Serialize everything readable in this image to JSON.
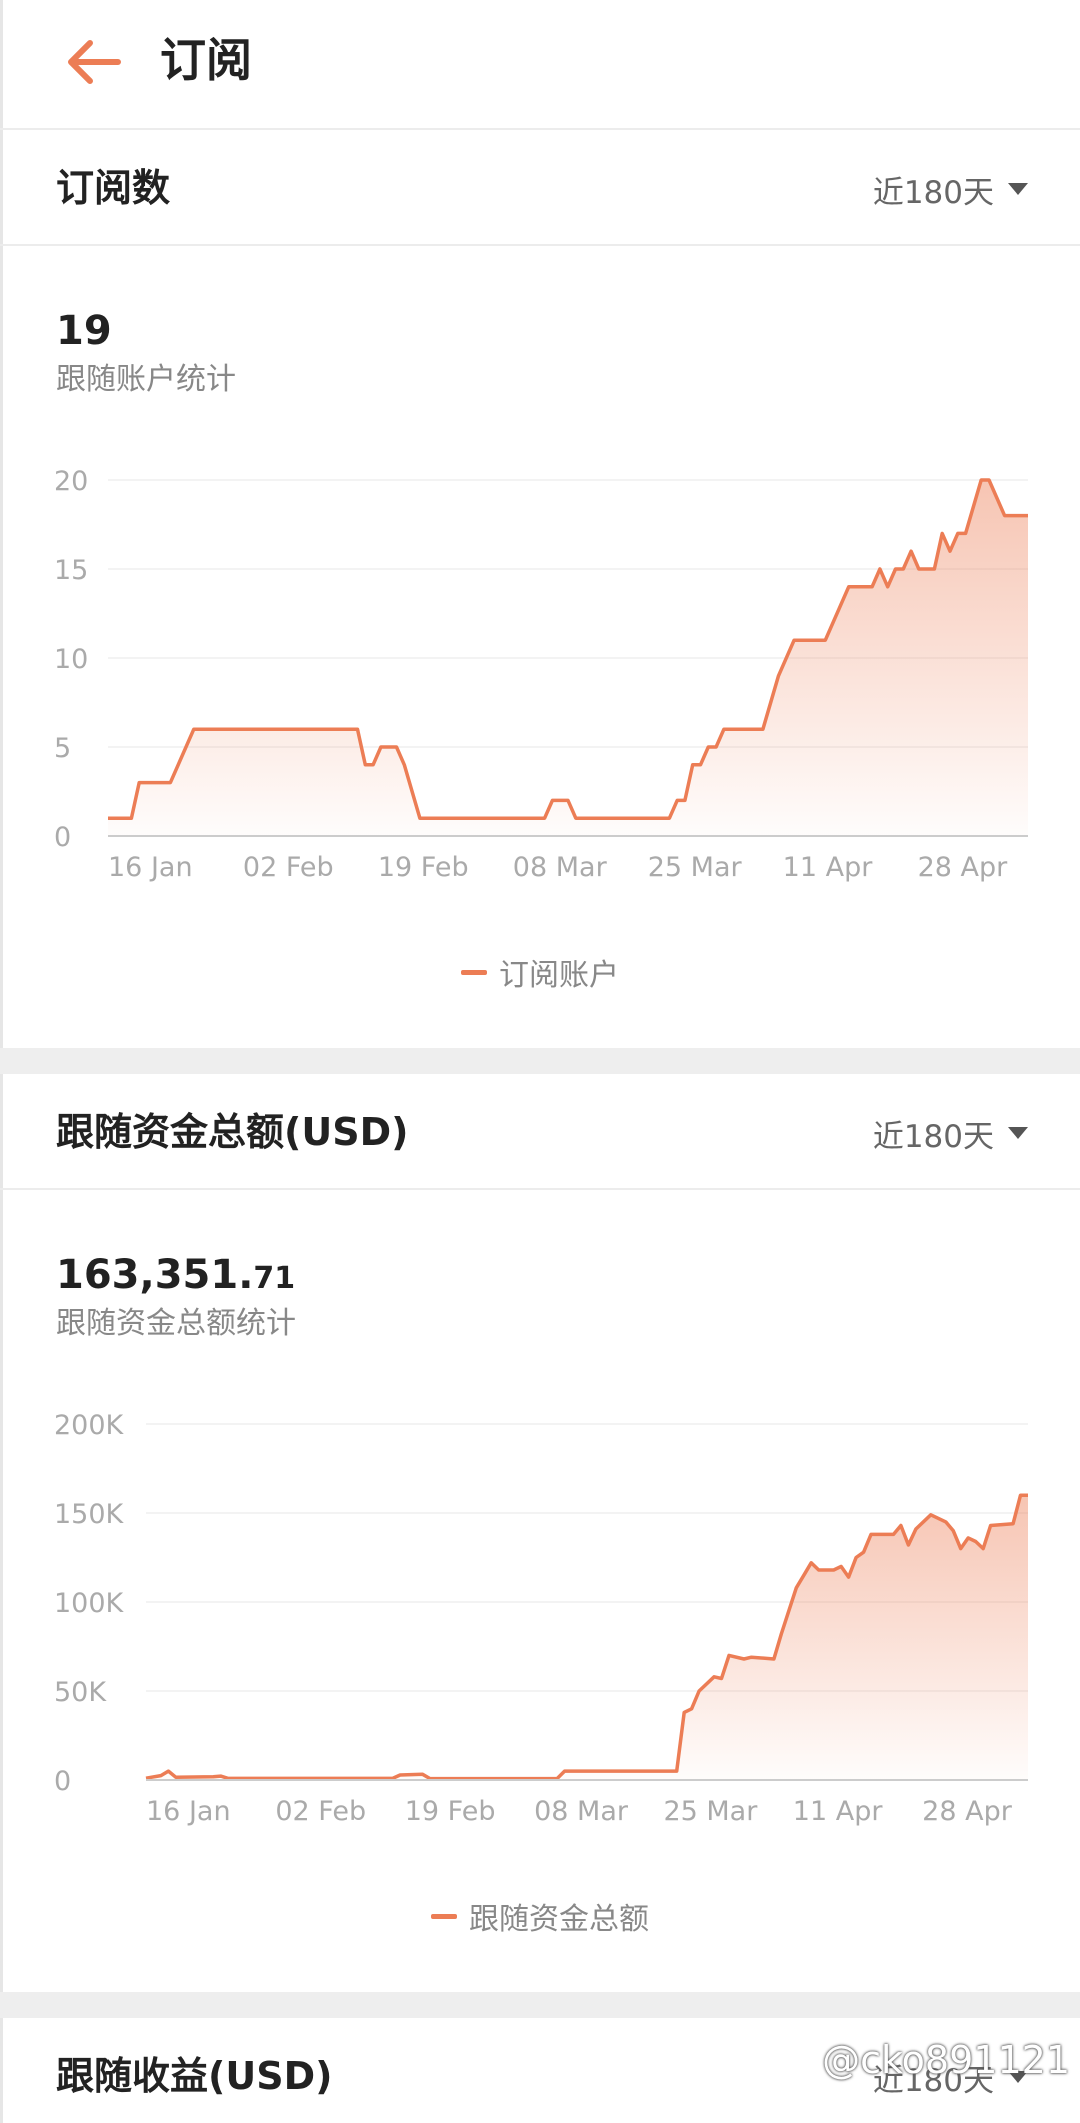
{
  "header": {
    "title": "订阅"
  },
  "colors": {
    "accent": "#ec7d55",
    "grid": "#efefef",
    "axis": "#cccccc",
    "tick": "#aaaaaa",
    "divider": "#eeeeee"
  },
  "icons": {
    "back": "arrow-left-icon",
    "dropdown": "caret-down-icon"
  },
  "sections": [
    {
      "title": "订阅数",
      "range": "近180天",
      "value_main": "19",
      "value_frac": "",
      "subtitle": "跟随账户统计",
      "legend": "订阅账户"
    },
    {
      "title": "跟随资金总额(USD)",
      "range": "近180天",
      "value_main": "163,351.",
      "value_frac": "71",
      "subtitle": "跟随资金总额统计",
      "legend": "跟随资金总额"
    },
    {
      "title": "跟随收益(USD)",
      "range": "近180天"
    }
  ],
  "chart_data": [
    {
      "type": "area",
      "title": "",
      "xlabel": "",
      "ylabel": "",
      "x_ticks": [
        "16 Jan",
        "02 Feb",
        "19 Feb",
        "08 Mar",
        "25 Mar",
        "11 Apr",
        "28 Apr"
      ],
      "y_ticks": [
        "0",
        "5",
        "10",
        "15",
        "20"
      ],
      "ylim": [
        0,
        20
      ],
      "xlim": [
        0,
        118
      ],
      "grid": true,
      "legend_position": "bottom",
      "series": [
        {
          "name": "订阅账户",
          "points": [
            [
              0,
              1
            ],
            [
              3,
              1
            ],
            [
              4,
              3
            ],
            [
              8,
              3
            ],
            [
              9,
              4
            ],
            [
              11,
              6
            ],
            [
              21,
              6
            ],
            [
              24,
              6
            ],
            [
              32,
              6
            ],
            [
              33,
              4
            ],
            [
              34,
              4
            ],
            [
              35,
              5
            ],
            [
              37,
              5
            ],
            [
              38,
              4
            ],
            [
              40,
              1
            ],
            [
              56,
              1
            ],
            [
              57,
              2
            ],
            [
              59,
              2
            ],
            [
              60,
              1
            ],
            [
              72,
              1
            ],
            [
              73,
              2
            ],
            [
              74,
              2
            ],
            [
              75,
              4
            ],
            [
              76,
              4
            ],
            [
              77,
              5
            ],
            [
              78,
              5
            ],
            [
              79,
              6
            ],
            [
              84,
              6
            ],
            [
              86,
              9
            ],
            [
              88,
              11
            ],
            [
              92,
              11
            ],
            [
              95,
              14
            ],
            [
              98,
              14
            ],
            [
              99,
              15
            ],
            [
              100,
              14
            ],
            [
              101,
              15
            ],
            [
              102,
              15
            ],
            [
              103,
              16
            ],
            [
              104,
              15
            ],
            [
              106,
              15
            ],
            [
              107,
              17
            ],
            [
              108,
              16
            ],
            [
              109,
              17
            ],
            [
              110,
              17
            ],
            [
              112,
              20
            ],
            [
              113,
              20
            ],
            [
              115,
              18
            ],
            [
              118,
              18
            ]
          ]
        }
      ]
    },
    {
      "type": "area",
      "title": "",
      "xlabel": "",
      "ylabel": "",
      "x_ticks": [
        "16 Jan",
        "02 Feb",
        "19 Feb",
        "08 Mar",
        "25 Mar",
        "11 Apr",
        "28 Apr"
      ],
      "y_ticks": [
        "0",
        "50K",
        "100K",
        "150K",
        "200K"
      ],
      "ylim": [
        0,
        200000
      ],
      "xlim": [
        0,
        118
      ],
      "grid": true,
      "legend_position": "bottom",
      "series": [
        {
          "name": "跟随资金总额",
          "points": [
            [
              0,
              1000
            ],
            [
              2,
              2500
            ],
            [
              3,
              5000
            ],
            [
              4,
              1500
            ],
            [
              9,
              1800
            ],
            [
              10,
              2200
            ],
            [
              11,
              900
            ],
            [
              33,
              900
            ],
            [
              34,
              2800
            ],
            [
              37,
              3200
            ],
            [
              38,
              800
            ],
            [
              55,
              800
            ],
            [
              56,
              5000
            ],
            [
              71,
              5000
            ],
            [
              72,
              38000
            ],
            [
              73,
              40000
            ],
            [
              74,
              50000
            ],
            [
              76,
              58000
            ],
            [
              77,
              57000
            ],
            [
              78,
              70000
            ],
            [
              80,
              68000
            ],
            [
              81,
              69000
            ],
            [
              84,
              68000
            ],
            [
              85,
              82000
            ],
            [
              87,
              108000
            ],
            [
              88,
              115000
            ],
            [
              89,
              122000
            ],
            [
              90,
              118000
            ],
            [
              92,
              118000
            ],
            [
              93,
              120000
            ],
            [
              94,
              114000
            ],
            [
              95,
              125000
            ],
            [
              96,
              128000
            ],
            [
              97,
              138000
            ],
            [
              100,
              138000
            ],
            [
              101,
              143000
            ],
            [
              102,
              132000
            ],
            [
              103,
              141000
            ],
            [
              105,
              149000
            ],
            [
              107,
              145000
            ],
            [
              108,
              140000
            ],
            [
              109,
              130000
            ],
            [
              110,
              136000
            ],
            [
              111,
              134000
            ],
            [
              112,
              130000
            ],
            [
              113,
              143000
            ],
            [
              116,
              144000
            ],
            [
              117,
              160000
            ],
            [
              118,
              160000
            ]
          ]
        }
      ]
    }
  ]
}
